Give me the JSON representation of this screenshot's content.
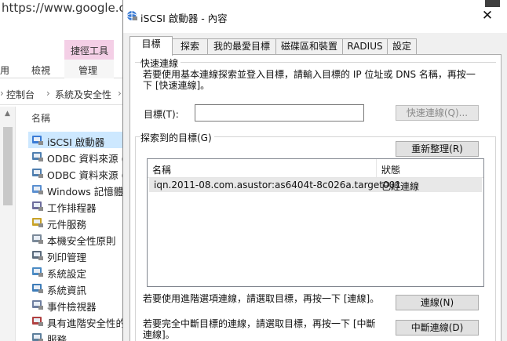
{
  "background": {
    "url_text": "https://www.google.co",
    "ribbon_context_tab": "捷徑工具",
    "ribbon_tabs": [
      "用",
      "檢視",
      "管理"
    ],
    "breadcrumb": [
      "控制台",
      "系統及安全性"
    ],
    "column_header": "名稱",
    "items": [
      {
        "label": "iSCSI 啟動器",
        "icon": "iscsi-icon",
        "selected": true
      },
      {
        "label": "ODBC 資料來源 (",
        "icon": "odbc-icon"
      },
      {
        "label": "ODBC 資料來源 (",
        "icon": "odbc-icon"
      },
      {
        "label": "Windows 記憶體",
        "icon": "memory-diagnostic-icon"
      },
      {
        "label": "工作排程器",
        "icon": "task-scheduler-icon"
      },
      {
        "label": "元件服務",
        "icon": "component-services-icon"
      },
      {
        "label": "本機安全性原則",
        "icon": "local-security-policy-icon"
      },
      {
        "label": "列印管理",
        "icon": "print-management-icon"
      },
      {
        "label": "系統設定",
        "icon": "system-configuration-icon"
      },
      {
        "label": "系統資訊",
        "icon": "system-information-icon"
      },
      {
        "label": "事件檢視器",
        "icon": "event-viewer-icon"
      },
      {
        "label": "具有進階安全性的",
        "icon": "firewall-icon"
      },
      {
        "label": "服務",
        "icon": "services-icon"
      }
    ]
  },
  "dialog": {
    "title": "iSCSI 啟動器 - 內容",
    "tabs": [
      "目標",
      "探索",
      "我的最愛目標",
      "磁碟區和裝置",
      "RADIUS",
      "設定"
    ],
    "quick_connect": {
      "group_label": "快速連線",
      "description": "若要使用基本連線探索並登入目標，請輸入目標的 IP 位址或 DNS 名稱，再按一下 [快速連線]。",
      "target_label": "目標(T):",
      "target_value": "",
      "button": "快速連線(Q)..."
    },
    "discovered": {
      "group_label": "探索到的目標(G)",
      "refresh_button": "重新整理(R)",
      "columns": [
        "名稱",
        "狀態"
      ],
      "rows": [
        {
          "name": "iqn.2011-08.com.asustor:as6404t-8c026a.target001",
          "status": "已經連線"
        }
      ],
      "connect_text": "若要使用進階選項連線，請選取目標，再按一下 [連線]。",
      "connect_button": "連線(N)",
      "disconnect_text": "若要完全中斷目標的連線，請選取目標，再按一下 [中斷連線]。",
      "disconnect_button": "中斷連線(D)"
    }
  }
}
